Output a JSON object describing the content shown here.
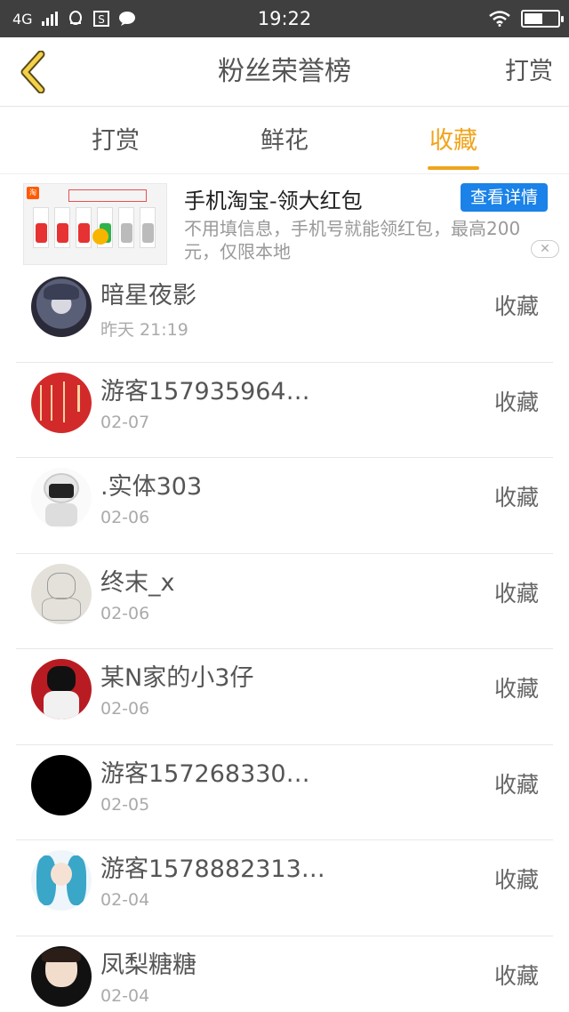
{
  "status_bar": {
    "network": "4G",
    "time": "19:22"
  },
  "header": {
    "back_icon": "chevron-left-icon",
    "title": "粉丝荣誉榜",
    "action": "打赏"
  },
  "tabs": [
    {
      "label": "打赏",
      "active": false
    },
    {
      "label": "鲜花",
      "active": false
    },
    {
      "label": "收藏",
      "active": true
    }
  ],
  "accent_color": "#f0a41c",
  "ad": {
    "title": "手机淘宝-领大红包",
    "cta": "查看详情",
    "description": "不用填信息，手机号就能领红包，最高200元，仅限本地"
  },
  "list": [
    {
      "name": "暗星夜影",
      "date": "昨天 21:19",
      "action": "收藏"
    },
    {
      "name": "游客157935964…",
      "date": "02-07",
      "action": "收藏"
    },
    {
      "name": ".实体303",
      "date": "02-06",
      "action": "收藏"
    },
    {
      "name": "终末_x",
      "date": "02-06",
      "action": "收藏"
    },
    {
      "name": "某N家的小3仔",
      "date": "02-06",
      "action": "收藏"
    },
    {
      "name": "游客157268330…",
      "date": "02-05",
      "action": "收藏"
    },
    {
      "name": "游客1578882313…",
      "date": "02-04",
      "action": "收藏"
    },
    {
      "name": "凤梨糖糖",
      "date": "02-04",
      "action": "收藏"
    }
  ]
}
